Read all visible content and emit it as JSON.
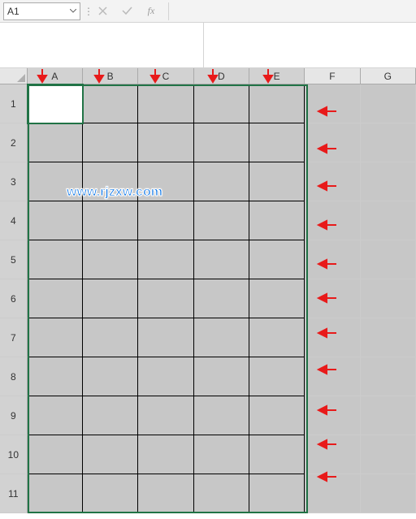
{
  "formula_bar": {
    "name_box_value": "A1",
    "fx_label": "fx"
  },
  "columns": [
    "A",
    "B",
    "C",
    "D",
    "E",
    "F",
    "G"
  ],
  "rows": [
    "1",
    "2",
    "3",
    "4",
    "5",
    "6",
    "7",
    "8",
    "9",
    "10",
    "11"
  ],
  "selected_cols": 5,
  "selected_rows": 11,
  "active_cell": "A1",
  "watermark": "www.rjzxw.com"
}
